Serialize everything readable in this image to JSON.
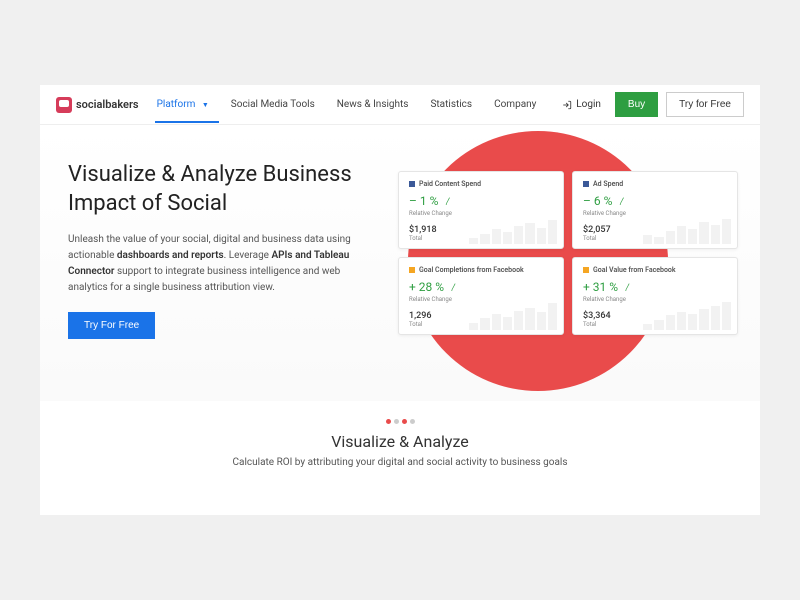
{
  "brand": "socialbakers",
  "nav": {
    "items": [
      {
        "label": "Platform",
        "active": true,
        "hasDropdown": true
      },
      {
        "label": "Social Media Tools"
      },
      {
        "label": "News & Insights"
      },
      {
        "label": "Statistics"
      },
      {
        "label": "Company"
      }
    ],
    "login": "Login",
    "buy": "Buy",
    "try": "Try for Free"
  },
  "hero": {
    "title": "Visualize & Analyze Business Impact of Social",
    "desc_pre": "Unleash the value of your social, digital and business data using actionable ",
    "desc_b1": "dashboards and reports",
    "desc_mid": ". Leverage ",
    "desc_b2": "APIs and Tableau Connector",
    "desc_post": " support to integrate business intelligence and web analytics for a single business attribution view.",
    "cta": "Try For Free"
  },
  "cards": [
    {
      "title": "Paid Content Spend",
      "icon": "fb",
      "metric": "– 1 %",
      "sub": "Relative Change",
      "total": "$1,918",
      "total_sub": "Total"
    },
    {
      "title": "Ad Spend",
      "icon": "fb",
      "metric": "– 6 %",
      "sub": "Relative Change",
      "total": "$2,057",
      "total_sub": "Total"
    },
    {
      "title": "Goal Completions from Facebook",
      "icon": "ga",
      "metric": "+ 28 %",
      "sub": "Relative Change",
      "total": "1,296",
      "total_sub": "Total"
    },
    {
      "title": "Goal Value from Facebook",
      "icon": "ga",
      "metric": "+ 31 %",
      "sub": "Relative Change",
      "total": "$3,364",
      "total_sub": "Total"
    }
  ],
  "section2": {
    "title": "Visualize & Analyze",
    "desc": "Calculate ROI by attributing your digital and social activity to business goals"
  }
}
